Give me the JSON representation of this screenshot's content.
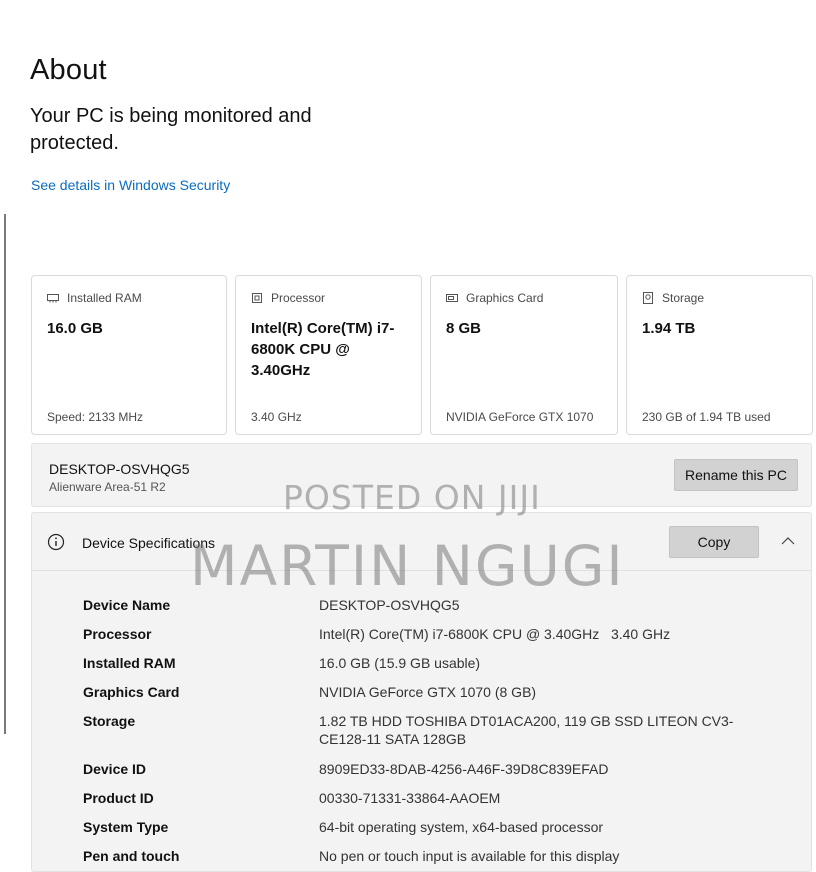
{
  "page": {
    "title": "About"
  },
  "security": {
    "status_text": "Your PC is being monitored and protected.",
    "link_text": "See details in Windows Security"
  },
  "cards": [
    {
      "title": "Installed RAM",
      "icon": "ram-icon",
      "value": "16.0 GB",
      "footer": "Speed: 2133 MHz"
    },
    {
      "title": "Processor",
      "icon": "processor-icon",
      "value": "Intel(R) Core(TM) i7-6800K CPU @ 3.40GHz",
      "footer": "3.40 GHz"
    },
    {
      "title": "Graphics Card",
      "icon": "graphics-card-icon",
      "value": "8 GB",
      "footer": "NVIDIA GeForce GTX 1070"
    },
    {
      "title": "Storage",
      "icon": "storage-icon",
      "value": "1.94 TB",
      "footer": "230 GB of 1.94 TB used"
    }
  ],
  "pc": {
    "name": "DESKTOP-OSVHQG5",
    "model": "Alienware Area-51 R2",
    "rename_label": "Rename this PC"
  },
  "specs": {
    "title": "Device Specifications",
    "copy_label": "Copy",
    "rows": [
      {
        "label": "Device Name",
        "value": "DESKTOP-OSVHQG5"
      },
      {
        "label": "Processor",
        "value": "Intel(R) Core(TM) i7-6800K CPU @ 3.40GHz   3.40 GHz"
      },
      {
        "label": "Installed RAM",
        "value": "16.0 GB (15.9 GB usable)"
      },
      {
        "label": "Graphics Card",
        "value": "NVIDIA GeForce GTX 1070 (8 GB)"
      },
      {
        "label": "Storage",
        "value": "1.82 TB HDD TOSHIBA DT01ACA200, 119 GB SSD LITEON CV3-CE128-11 SATA 128GB"
      },
      {
        "label": "Device ID",
        "value": "8909ED33-8DAB-4256-A46F-39D8C839EFAD"
      },
      {
        "label": "Product ID",
        "value": "00330-71331-33864-AAOEM"
      },
      {
        "label": "System Type",
        "value": "64-bit operating system, x64-based processor"
      },
      {
        "label": "Pen and touch",
        "value": "No pen or touch input is available for this display"
      }
    ]
  },
  "watermark": {
    "line1": "POSTED ON JIJI",
    "line2": "MARTIN NGUGI"
  },
  "colors": {
    "link": "#0a6cbf",
    "button_bg": "#d2d2d2",
    "panel_bg": "#f3f3f3"
  }
}
